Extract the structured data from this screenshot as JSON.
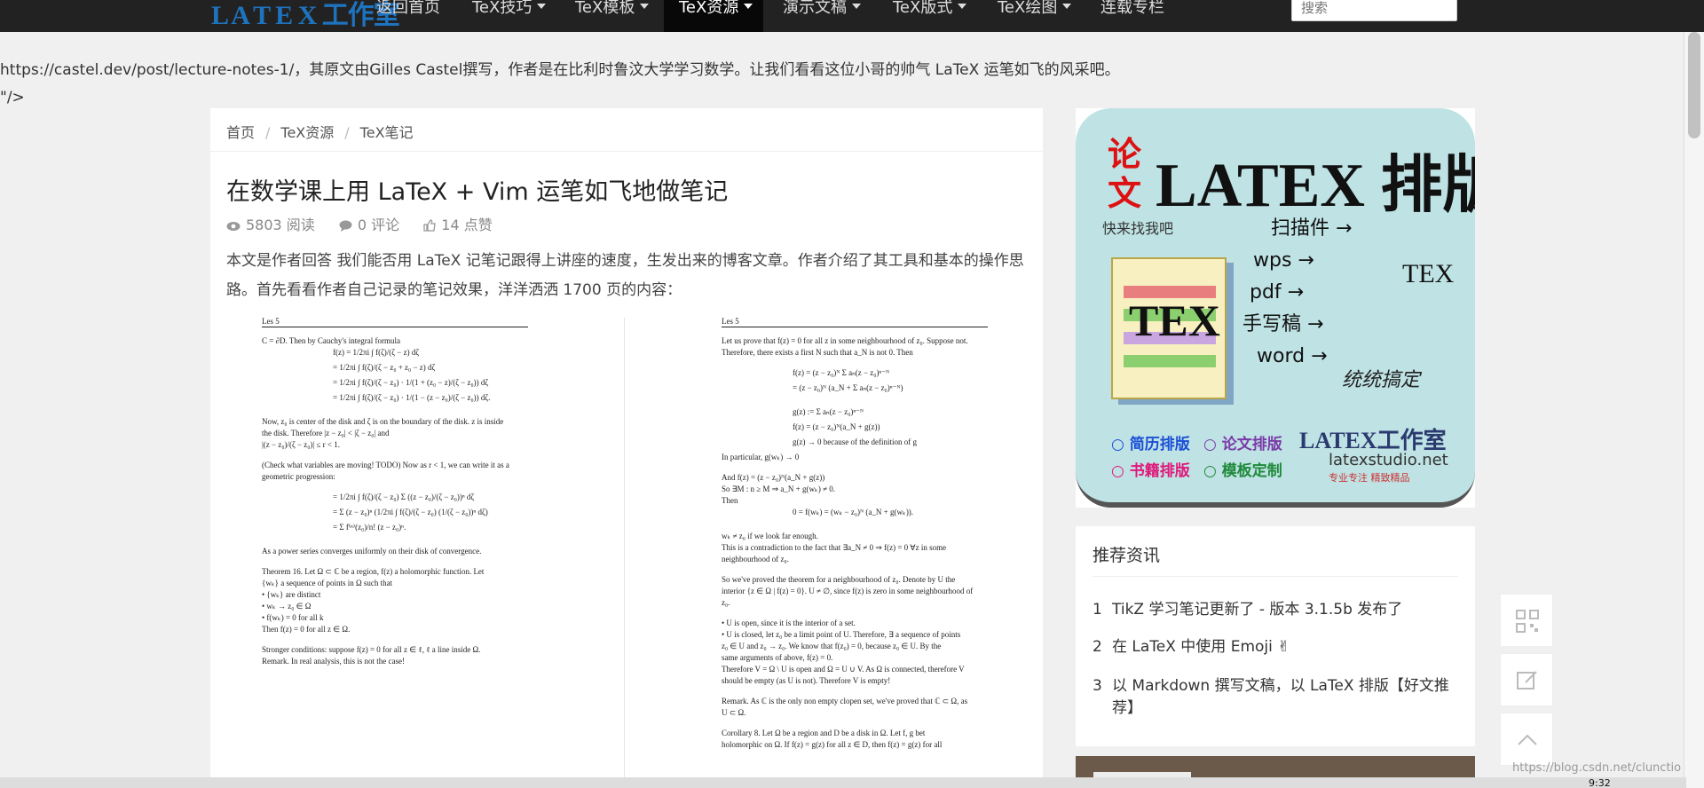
{
  "topnav": {
    "logo_text": "L A T E X 工作室",
    "items": [
      {
        "label": "返回首页",
        "dropdown": false
      },
      {
        "label": "TeX技巧",
        "dropdown": true
      },
      {
        "label": "TeX模板",
        "dropdown": true
      },
      {
        "label": "TeX资源",
        "dropdown": true,
        "active": true
      },
      {
        "label": "演示文稿",
        "dropdown": true
      },
      {
        "label": "TeX版式",
        "dropdown": true
      },
      {
        "label": "TeX绘图",
        "dropdown": true
      },
      {
        "label": "连载专栏",
        "dropdown": false
      }
    ],
    "search_placeholder": "搜索"
  },
  "intro": {
    "text": "https://castel.dev/post/lecture-notes-1/，其原文由Gilles Castel撰写，作者是在比利时鲁汶大学学习数学。让我们看看这位小哥的帅气 LaTeX 运笔如飞的风采吧。",
    "stray": "\"/>"
  },
  "article": {
    "breadcrumb": [
      "首页",
      "TeX资源",
      "TeX笔记"
    ],
    "title": "在数学课上用 LaTeX + Vim 运笔如飞地做笔记",
    "meta": {
      "views": "5803 阅读",
      "comments": "0 评论",
      "likes": "14 点赞"
    },
    "summary": "本文是作者回答 我们能否用 LaTeX 记笔记跟得上讲座的速度，生发出来的博客文章。作者介绍了其工具和基本的操作思路。首先看看作者自己记录的笔记效果，洋洋洒洒 1700 页的内容：",
    "notes": {
      "left_header": "Les 5",
      "right_header": "Les 5",
      "left_lines": [
        "C = ∂D. Then by Cauchy's integral formula",
        "f(z) = 1/2πi ∫ f(ζ)/(ζ − z) dζ",
        "= 1/2πi ∫ f(ζ)/(ζ − z₀ + z₀ − z) dζ",
        "= 1/2πi ∫ f(ζ)/(ζ − z₀) · 1/(1 + (z₀ − z)/(ζ − z₀)) dζ",
        "= 1/2πi ∫ f(ζ)/(ζ − z₀) · 1/(1 − (z − z₀)/(ζ − z₀)) dζ.",
        "Now, z₀ is center of the disk and ζ is on the boundary of the disk. z is inside",
        "the disk. Therefore |z − z₀| < |ζ − z₀| and",
        "|(z − z₀)/(ζ − z₀)| ≤ r < 1.",
        "(Check what variables are moving! TODO) Now as r < 1, we can write it as a",
        "geometric progression:",
        "= 1/2πi ∫ f(ζ)/(ζ − z₀) Σ ((z − z₀)/(ζ − z₀))ⁿ dζ",
        "= Σ (z − z₀)ⁿ (1/2πi ∫ f(ζ)/(ζ − z₀) (1/(ζ − z₀))ⁿ dζ)",
        "= Σ f⁽ⁿ⁾(z₀)/n! (z − z₀)ⁿ.",
        "As a power series converges uniformly on their disk of convergence.",
        "Theorem 16. Let Ω ⊂ ℂ be a region, f(z) a holomorphic function. Let",
        "{wₖ} a sequence of points in Ω such that",
        "• {wₖ} are distinct",
        "• wₖ → z₀ ∈ Ω",
        "• f(wₖ) = 0 for all k",
        "Then f(z) = 0 for all z ∈ Ω.",
        "Stronger conditions: suppose f(z) = 0 for all z ∈ ℓ, ℓ a line inside Ω.",
        "Remark. In real analysis, this is not the case!"
      ],
      "right_lines": [
        "Let us prove that f(z) = 0 for all z in some neighbourhood of z₀. Suppose not.",
        "Therefore, there exists a first N such that a_N is not 0. Then",
        "f(z) = (z − z₀)ᴺ Σ aₙ(z − z₀)ⁿ⁻ᴺ",
        "= (z − z₀)ᴺ (a_N + Σ aₙ(z − z₀)ⁿ⁻ᴺ)",
        "g(z) := Σ aₙ(z − z₀)ⁿ⁻ᴺ",
        "f(z) = (z − z₀)ᴺ(a_N + g(z))",
        "g(z) → 0 because of the definition of g",
        "In particular, g(wₖ) → 0",
        "And f(z) = (z − z₀)ᴺ(a_N + g(z))",
        "So ∃M : n ≥ M ⇒ a_N + g(wₖ) ≠ 0.",
        "Then",
        "0 = f(wₖ) = (wₖ − z₀)ᴺ (a_N + g(wₖ)).",
        "wₖ ≠ z₀ if we look far enough.",
        "This is a contradiction to the fact that ∃a_N ≠ 0 ⇒ f(z) = 0 ∀z in some",
        "neighbourhood of z₀.",
        "So we've proved the theorem for a neighbourhood of z₀. Denote by U the",
        "interior {z ∈ Ω | f(z) = 0}. U ≠ ∅, since f(z) is zero in some neighbourhood of",
        "z₀.",
        "• U is open, since it is the interior of a set.",
        "• U is closed, let z₀ be a limit point of U. Therefore, ∃ a sequence of points",
        "z₀ ∈ U and z₀ → z₀. We know that f(z₀) = 0, because z₀ ∈ U. By the",
        "same arguments of above, f(z) = 0.",
        "Therefore V = Ω \\ U is open and Ω = U ∪ V. As Ω is connected, therefore V",
        "should be empty (as U is not). Therefore V is empty!",
        "Remark. As ℂ is the only non empty clopen set, we've proved that ℂ ⊂ Ω, as",
        "U ⊂ Ω.",
        "Corollary 8. Let Ω be a region and D be a disk in Ω. Let f, g bet",
        "holomorphic on Ω. If f(z) = g(z) for all z ∈ D, then f(z) = g(z) for all"
      ]
    }
  },
  "ad": {
    "lunwen": "论文",
    "logo": "LATEX 排版",
    "subtitle": "快来找我吧",
    "paper_tex": "TEX",
    "arrows": [
      "扫描件 →",
      "wps →",
      "pdf →",
      "手写稿 →",
      "word →"
    ],
    "tex_right": "TEX",
    "slogan": "统统搞定",
    "services": [
      {
        "label": "○ 简历排版",
        "color": "#1a4fd6"
      },
      {
        "label": "○ 论文排版",
        "color": "#7a3aa8"
      },
      {
        "label": "○ 书籍排版",
        "color": "#e0187a"
      },
      {
        "label": "○ 模板定制",
        "color": "#1e8a3a"
      }
    ],
    "brand": "LATEX工作室",
    "url": "latexstudio.net",
    "tagline": "专业专注 精致精品"
  },
  "recommend": {
    "title": "推荐资讯",
    "items": [
      {
        "num": "1",
        "label": "TikZ 学习笔记更新了 - 版本 3.1.5b 发布了"
      },
      {
        "num": "2",
        "label": "在 LaTeX 中使用 Emoji ✌"
      },
      {
        "num": "3",
        "label": "以 Markdown 撰写文稿，以 LaTeX 排版【好文推荐】"
      }
    ]
  },
  "side_tools": [
    "qrcode-icon",
    "edit-icon",
    "back-to-top-icon"
  ],
  "watermark": "https://blog.csdn.net/clunctio",
  "taskbar_page": "9:32"
}
